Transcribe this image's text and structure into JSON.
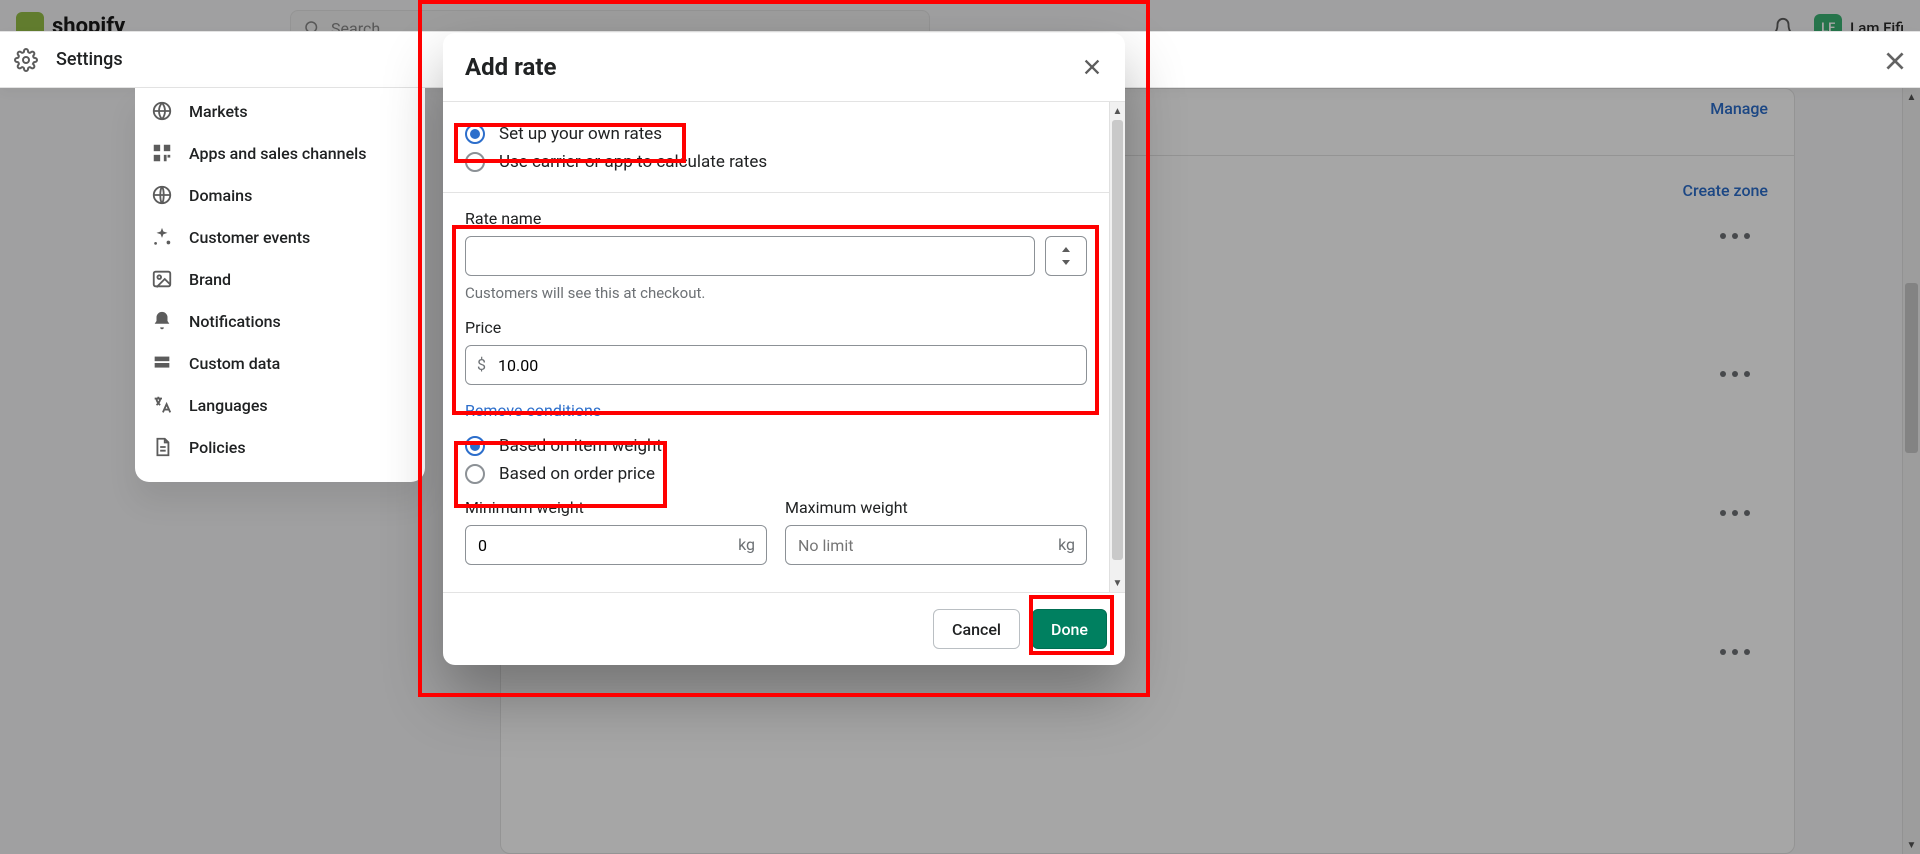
{
  "topbar": {
    "brand": "shopify",
    "search_placeholder": "Search",
    "user_initials": "LF",
    "user_name": "Lam Fifi"
  },
  "settings_header": {
    "title": "Settings"
  },
  "sidebar": {
    "items": [
      {
        "label": "Markets"
      },
      {
        "label": "Apps and sales channels"
      },
      {
        "label": "Domains"
      },
      {
        "label": "Customer events"
      },
      {
        "label": "Brand"
      },
      {
        "label": "Notifications"
      },
      {
        "label": "Custom data"
      },
      {
        "label": "Languages"
      },
      {
        "label": "Policies"
      }
    ]
  },
  "background": {
    "manage": "Manage",
    "create_zone": "Create zone"
  },
  "modal": {
    "title": "Add rate",
    "option_own": "Set up your own rates",
    "option_carrier": "Use carrier or app to calculate rates",
    "rate_name_label": "Rate name",
    "rate_name_value": "",
    "rate_name_help": "Customers will see this at checkout.",
    "price_label": "Price",
    "price_currency": "$",
    "price_value": "10.00",
    "remove_conditions": "Remove conditions",
    "cond_weight": "Based on item weight",
    "cond_price": "Based on order price",
    "min_weight_label": "Minimum weight",
    "min_weight_value": "0",
    "max_weight_label": "Maximum weight",
    "max_weight_placeholder": "No limit",
    "weight_unit": "kg",
    "cancel": "Cancel",
    "done": "Done"
  }
}
